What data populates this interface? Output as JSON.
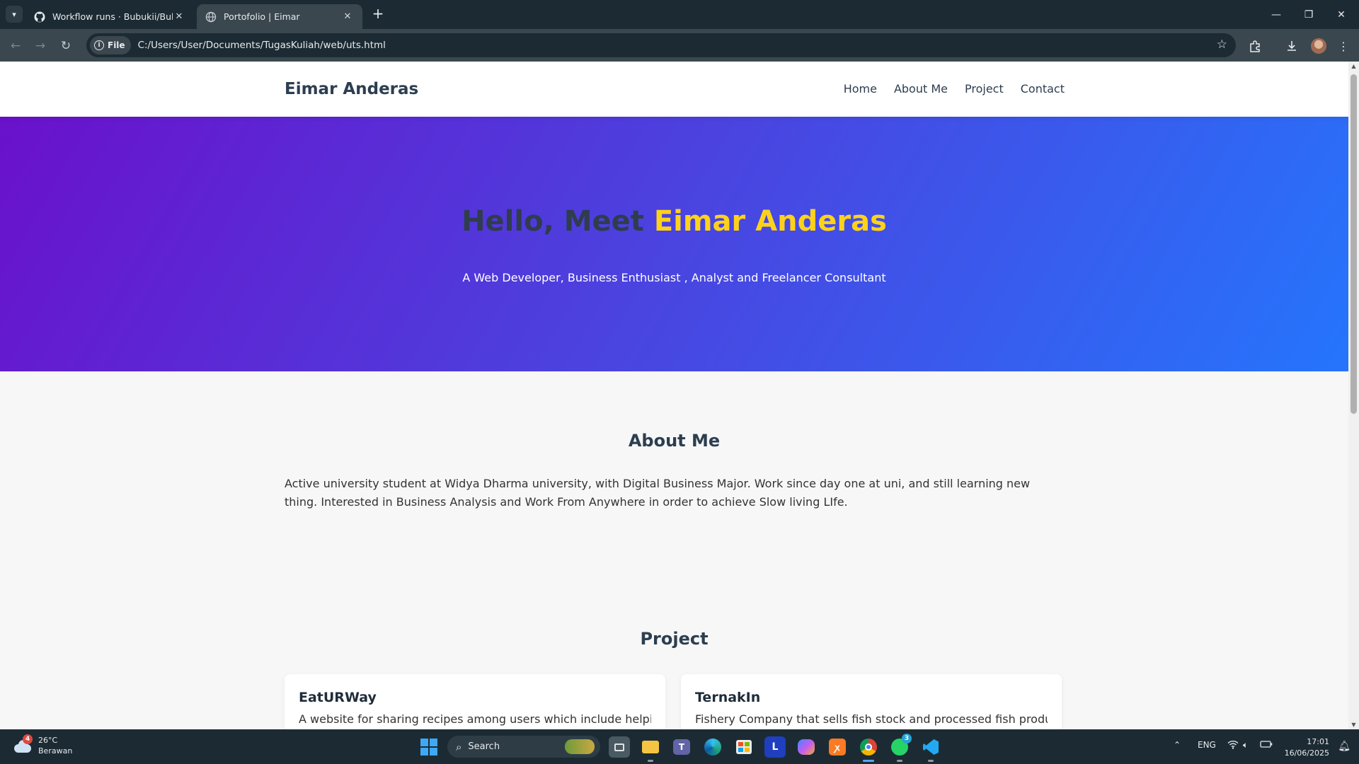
{
  "browser": {
    "tabs": [
      {
        "title": "Workflow runs · Bubukii/Bubukii",
        "favicon": "github-icon",
        "active": false
      },
      {
        "title": "Portofolio | Eimar",
        "favicon": "globe-icon",
        "active": true
      }
    ],
    "new_tab_label": "+",
    "file_chip_label": "File",
    "url": "C:/Users/User/Documents/TugasKuliah/web/uts.html"
  },
  "site": {
    "brand": "Eimar Anderas",
    "nav": [
      "Home",
      "About Me",
      "Project",
      "Contact"
    ],
    "hero": {
      "greeting": "Hello, Meet ",
      "name": "Eimar Anderas",
      "tagline": "A Web Developer, Business Enthusiast , Analyst and Freelancer Consultant"
    },
    "about": {
      "title": "About Me",
      "text": "Active university student at Widya Dharma university, with Digital Business Major. Work since day one at uni, and still learning new thing. Interested in Business Analysis and Work From Anywhere in order to achieve Slow living LIfe."
    },
    "projects": {
      "title": "Project",
      "items": [
        {
          "name": "EatURWay",
          "desc": "A website for sharing recipes among users which include helping them"
        },
        {
          "name": "TernakIn",
          "desc": "Fishery Company that sells fish stock and processed fish product. Act"
        }
      ]
    }
  },
  "taskbar": {
    "weather": {
      "temp": "26°C",
      "condition": "Berawan",
      "badge": "4"
    },
    "search_label": "Search",
    "whatsapp_badge": "3",
    "language": "ENG",
    "time": "17:01",
    "date": "16/06/2025"
  },
  "colors": {
    "hero_gradient_start": "#6a11cb",
    "hero_gradient_end": "#2575fc",
    "highlight": "#ffd21a",
    "heading": "#2c3e50"
  }
}
